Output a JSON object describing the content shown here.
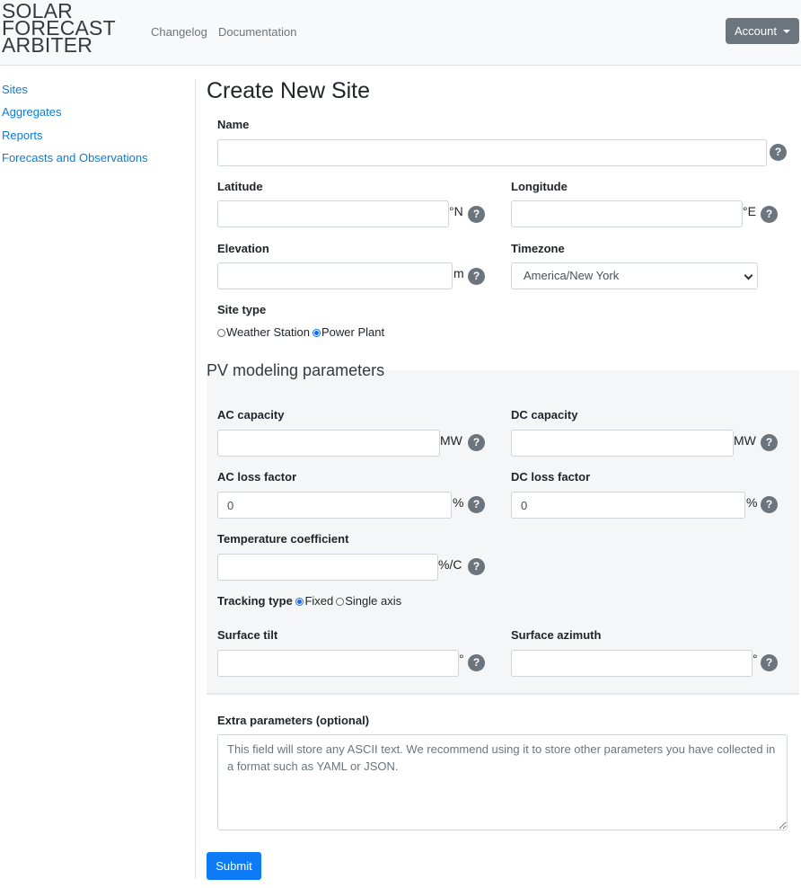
{
  "navbar": {
    "brand_lines": [
      "SOLAR",
      "FORECAST",
      "ARBITER"
    ],
    "links": [
      "Changelog",
      "Documentation"
    ],
    "account_label": "Account"
  },
  "sidebar": {
    "items": [
      {
        "label": "Sites"
      },
      {
        "label": "Aggregates"
      },
      {
        "label": "Reports"
      },
      {
        "label": "Forecasts and Observations"
      }
    ]
  },
  "page": {
    "title": "Create New Site",
    "help_glyph": "?"
  },
  "form": {
    "name": {
      "label": "Name",
      "value": ""
    },
    "latitude": {
      "label": "Latitude",
      "value": "",
      "unit": "°N"
    },
    "longitude": {
      "label": "Longitude",
      "value": "",
      "unit": "°E"
    },
    "elevation": {
      "label": "Elevation",
      "value": "",
      "unit": "m"
    },
    "timezone": {
      "label": "Timezone",
      "selected": "America/New York"
    },
    "site_type": {
      "label": "Site type",
      "options": [
        {
          "label": "Weather Station",
          "checked": false
        },
        {
          "label": "Power Plant",
          "checked": true
        }
      ]
    }
  },
  "pv": {
    "heading": "PV modeling parameters",
    "ac_capacity": {
      "label": "AC capacity",
      "value": "",
      "unit": "MW"
    },
    "dc_capacity": {
      "label": "DC capacity",
      "value": "",
      "unit": "MW"
    },
    "ac_loss_factor": {
      "label": "AC loss factor",
      "value": "0",
      "unit": "%"
    },
    "dc_loss_factor": {
      "label": "DC loss factor",
      "value": "0",
      "unit": "%"
    },
    "temperature_coefficient": {
      "label": "Temperature coefficient",
      "value": "",
      "unit": "%/C"
    },
    "tracking_type": {
      "label": "Tracking type",
      "options": [
        {
          "label": "Fixed",
          "checked": true
        },
        {
          "label": "Single axis",
          "checked": false
        }
      ]
    },
    "surface_tilt": {
      "label": "Surface tilt",
      "value": "",
      "unit": "°"
    },
    "surface_azimuth": {
      "label": "Surface azimuth",
      "value": "",
      "unit": "°"
    }
  },
  "extra": {
    "label": "Extra parameters (optional)",
    "value": "",
    "placeholder": "This field will store any ASCII text. We recommend using it to store other parameters you have collected in a format such as YAML or JSON."
  },
  "submit_label": "Submit",
  "colors": {
    "link": "#0d7bd6",
    "primary_button": "#0d7bf5",
    "secondary_button": "#6c757d",
    "panel_background": "#f5f6f8"
  }
}
